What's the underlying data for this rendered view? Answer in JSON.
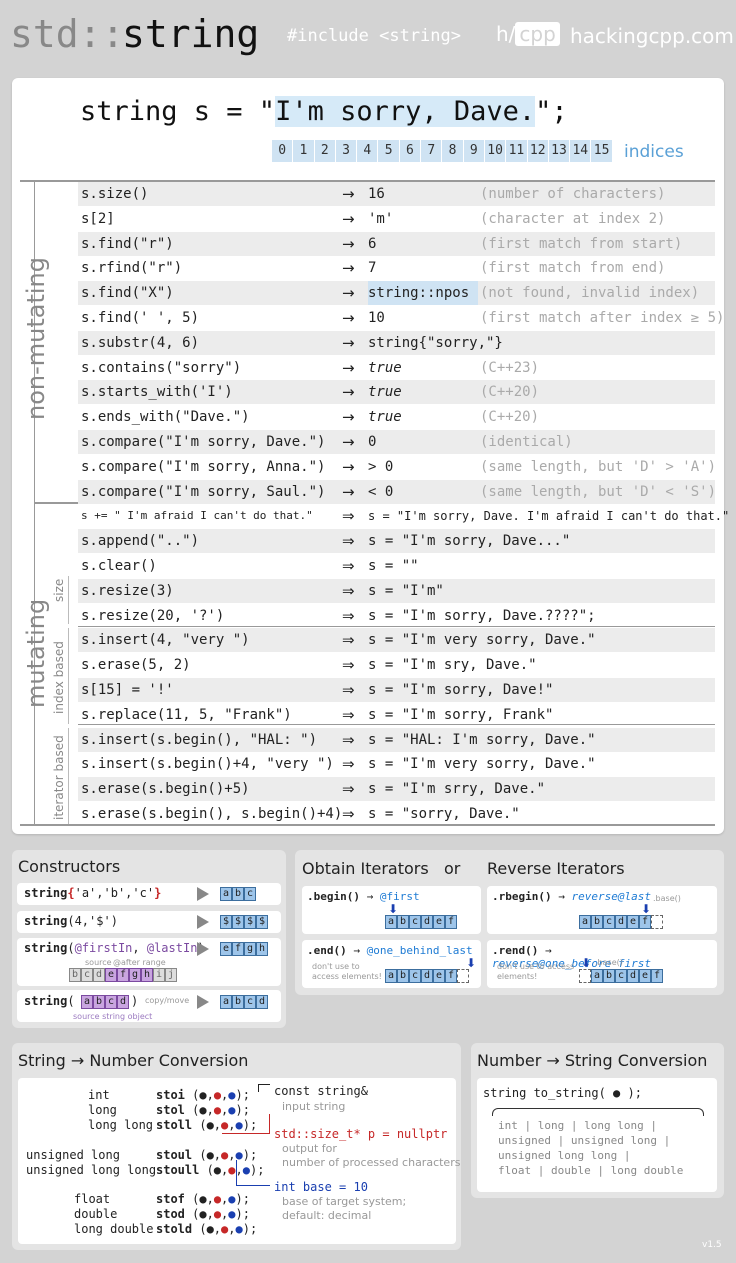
{
  "header": {
    "std": "std::",
    "string": "string",
    "include": "#include <string>",
    "logo_h": "h/",
    "logo_cpp": "cpp",
    "site": "hackingcpp.com"
  },
  "decl": {
    "pre": "string s = \"",
    "hl": "I'm sorry, Dave.",
    "post": "\";",
    "indices": [
      "0",
      "1",
      "2",
      "3",
      "4",
      "5",
      "6",
      "7",
      "8",
      "9",
      "10",
      "11",
      "12",
      "13",
      "14",
      "15"
    ],
    "indices_label": "indices"
  },
  "labels": {
    "non_mutating": "non-mutating",
    "mutating": "mutating",
    "size": "size",
    "index_based": "index based",
    "iterator_based": "iterator based"
  },
  "rows": [
    {
      "c": "s.size()",
      "a": "→",
      "r": "16",
      "m": "(number of characters)"
    },
    {
      "c": "s[2]",
      "a": "→",
      "r": "'m'",
      "m": "(character at index 2)"
    },
    {
      "c": "s.find(\"r\")",
      "a": "→",
      "r": "6",
      "m": "(first match from start)"
    },
    {
      "c": "s.rfind(\"r\")",
      "a": "→",
      "r": "7",
      "m": "(first match from end)"
    },
    {
      "c": "s.find(\"X\")",
      "a": "→",
      "r": "string::npos",
      "m": "(not found, invalid index)"
    },
    {
      "c": "s.find(' ', 5)",
      "a": "→",
      "r": "10",
      "m": "(first match after index ≥ 5)"
    },
    {
      "c": "s.substr(4, 6)",
      "a": "→",
      "r": "string{\"sorry,\"}",
      "m": ""
    },
    {
      "c": "s.contains(\"sorry\")",
      "a": "→",
      "r": "true",
      "m": "(C++23)"
    },
    {
      "c": "s.starts_with('I')",
      "a": "→",
      "r": "true",
      "m": "(C++20)"
    },
    {
      "c": "s.ends_with(\"Dave.\")",
      "a": "→",
      "r": "true",
      "m": "(C++20)"
    },
    {
      "c": "s.compare(\"I'm sorry, Dave.\")",
      "a": "→",
      "r": "0",
      "m": "(identical)"
    },
    {
      "c": "s.compare(\"I'm sorry, Anna.\")",
      "a": "→",
      "r": "> 0",
      "m": "(same length, but 'D' > 'A')"
    },
    {
      "c": "s.compare(\"I'm sorry, Saul.\")",
      "a": "→",
      "r": "< 0",
      "m": "(same length, but 'D' < 'S')"
    },
    {
      "c": "s += \" I'm afraid I can't do that.\"",
      "a": "⇒",
      "r": "s = \"I'm sorry, Dave. I'm afraid I can't do that.\"",
      "m": ""
    },
    {
      "c": "s.append(\"..\")",
      "a": "⇒",
      "r": "s = \"I'm sorry, Dave...\"",
      "m": ""
    },
    {
      "c": "s.clear()",
      "a": "⇒",
      "r": "s = \"\"",
      "m": ""
    },
    {
      "c": "s.resize(3)",
      "a": "⇒",
      "r": "s = \"I'm\"",
      "m": ""
    },
    {
      "c": "s.resize(20, '?')",
      "a": "⇒",
      "r": "s = \"I'm sorry, Dave.????\";",
      "m": ""
    },
    {
      "c": "s.insert(4, \"very \")",
      "a": "⇒",
      "r": "s = \"I'm very sorry, Dave.\"",
      "m": ""
    },
    {
      "c": "s.erase(5, 2)",
      "a": "⇒",
      "r": "s = \"I'm sry, Dave.\"",
      "m": ""
    },
    {
      "c": "s[15] = '!'",
      "a": "⇒",
      "r": "s = \"I'm sorry, Dave!\"",
      "m": ""
    },
    {
      "c": "s.replace(11, 5, \"Frank\")",
      "a": "⇒",
      "r": "s = \"I'm sorry, Frank\"",
      "m": ""
    },
    {
      "c": "s.insert(s.begin(), \"HAL: \")",
      "a": "⇒",
      "r": "s = \"HAL: I'm sorry, Dave.\"",
      "m": ""
    },
    {
      "c": "s.insert(s.begin()+4, \"very \")",
      "a": "⇒",
      "r": "s = \"I'm very sorry, Dave.\"",
      "m": ""
    },
    {
      "c": "s.erase(s.begin()+5)",
      "a": "⇒",
      "r": "s = \"I'm srry, Dave.\"",
      "m": ""
    },
    {
      "c": "s.erase(s.begin(), s.begin()+4)",
      "a": "⇒",
      "r": "s = \"sorry, Dave.\"",
      "m": ""
    }
  ],
  "constructors": {
    "title": "Constructors",
    "c1": "string{'a','b','c'}",
    "c2": "string(4,'$')",
    "c3": "string(@firstIn, @lastIn)",
    "c4": "string( abcd )",
    "source_label": "source",
    "after_label": "@after range",
    "copy_move": "copy/move",
    "source_obj": "source string object",
    "cells_abc": [
      "a",
      "b",
      "c"
    ],
    "cells_dollar": [
      "$",
      "$",
      "$",
      "$"
    ],
    "cells_efgh": [
      "e",
      "f",
      "g",
      "h"
    ],
    "cells_range": [
      "b",
      "c",
      "d",
      "e",
      "f",
      "g",
      "h",
      "i",
      "j"
    ],
    "cells_abcd": [
      "a",
      "b",
      "c",
      "d"
    ]
  },
  "iters": {
    "title_obtain": "Obtain Iterators",
    "or": "or",
    "title_reverse": "Reverse Iterators",
    "begin": ".begin()",
    "first": "@first",
    "end": ".end()",
    "one_behind": "@one_behind_last",
    "dont": "don't use to access elements!",
    "rbegin": ".rbegin()",
    "rev_last": "reverse@last",
    "rbase": ".base()",
    "rend": ".rend()",
    "rev_one_before": "reverse@one_before_first",
    "cells": [
      "a",
      "b",
      "c",
      "d",
      "e",
      "f"
    ]
  },
  "stonum": {
    "title": "String → Number  Conversion",
    "types": [
      "int",
      "long",
      "long long",
      "unsigned long",
      "unsigned long long",
      "float",
      "double",
      "long double"
    ],
    "funcs": [
      "stoi",
      "stol",
      "stoll",
      "stoul",
      "stoull",
      "stof",
      "stod",
      "stold"
    ],
    "const_string": "const string&",
    "input_string": "input string",
    "size_t": "std::size_t* p = nullptr",
    "output_for": "output for",
    "num_processed": "number of processed characters",
    "int_base": "int base = 10",
    "base_of": "base of target system;",
    "default": "default: decimal"
  },
  "numtos": {
    "title": "Number → String  Conversion",
    "sig": "string to_string( ● );",
    "types": "int | long | long long |\nunsigned | unsigned long |\nunsigned long long |\nfloat | double | long double"
  },
  "version": "v1.5"
}
